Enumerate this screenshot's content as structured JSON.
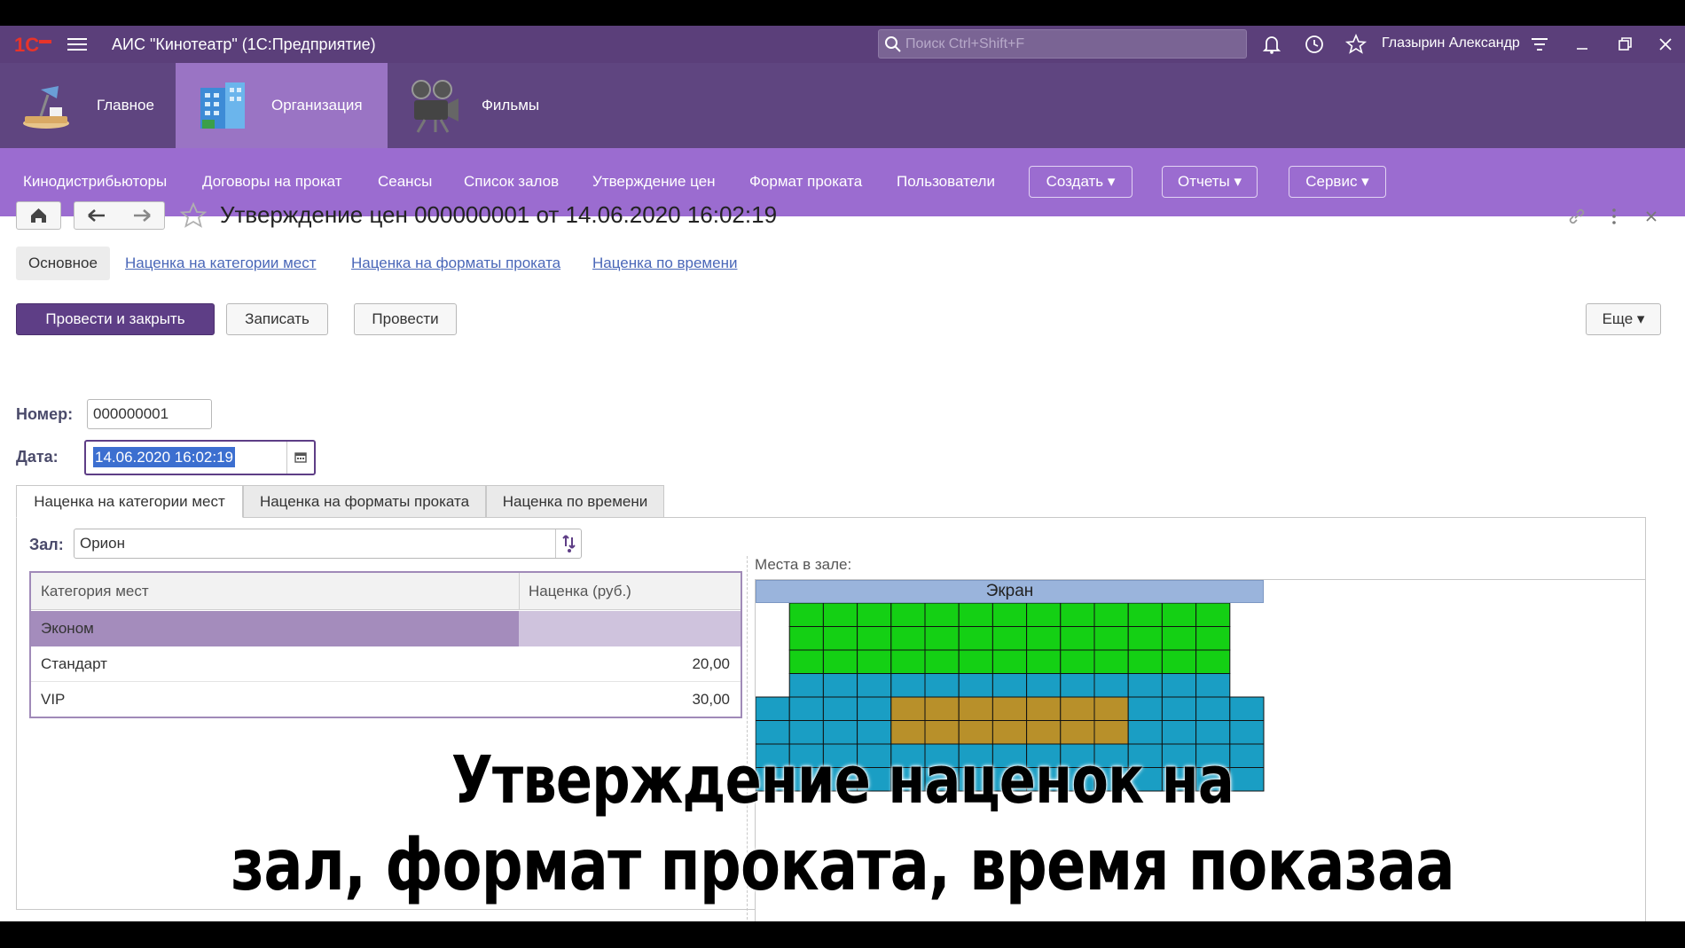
{
  "titlebar": {
    "title": "АИС \"Кинотеатр\"  (1С:Предприятие)",
    "search_placeholder": "Поиск Ctrl+Shift+F",
    "user": "Глазырин Александр",
    "icons": [
      "1c-logo-icon",
      "menu-icon",
      "search-icon",
      "bell-icon",
      "history-icon",
      "star-icon",
      "filter-icon",
      "minimize-icon",
      "restore-icon",
      "close-icon"
    ]
  },
  "sections": [
    {
      "label": "Главное",
      "icon": "desk-lamp-icon"
    },
    {
      "label": "Организация",
      "icon": "building-icon"
    },
    {
      "label": "Фильмы",
      "icon": "film-projector-icon"
    }
  ],
  "funcbar": {
    "links": [
      "Кинодистрибьюторы",
      "Договоры на прокат",
      "Сеансы",
      "Список залов",
      "Утверждение цен",
      "Формат проката",
      "Пользователи"
    ],
    "buttons": [
      "Создать ▾",
      "Отчеты ▾",
      "Сервис ▾"
    ]
  },
  "document": {
    "title": "Утверждение цен 000000001 от 14.06.2020 16:02:19",
    "subtabs": [
      "Основное",
      "Наценка на категории мест",
      "Наценка на форматы проката",
      "Наценка по времени"
    ],
    "commands": {
      "post_close": "Провести и закрыть",
      "write": "Записать",
      "post": "Провести",
      "more": "Еще ▾"
    },
    "number_label": "Номер:",
    "number_value": "000000001",
    "date_label": "Дата:",
    "date_value": "14.06.2020 16:02:19"
  },
  "inner_tabs": [
    "Наценка на категории мест",
    "Наценка на форматы проката",
    "Наценка по времени"
  ],
  "hall": {
    "label": "Зал:",
    "value": "Орион"
  },
  "table": {
    "headers": [
      "Категория мест",
      "Наценка (руб.)"
    ],
    "rows": [
      {
        "category": "Эконом",
        "markup": ""
      },
      {
        "category": "Стандарт",
        "markup": "20,00"
      },
      {
        "category": "VIP",
        "markup": "30,00"
      }
    ]
  },
  "seats": {
    "label": "Места в зале:",
    "screen": "Экран",
    "colors": {
      "econom": "#14d014",
      "standard": "#1a9ec4",
      "vip": "#b8902a"
    }
  },
  "overlay": {
    "line1": "Утверждение наценок на",
    "line2": "зал, формат проката, время показаа"
  }
}
